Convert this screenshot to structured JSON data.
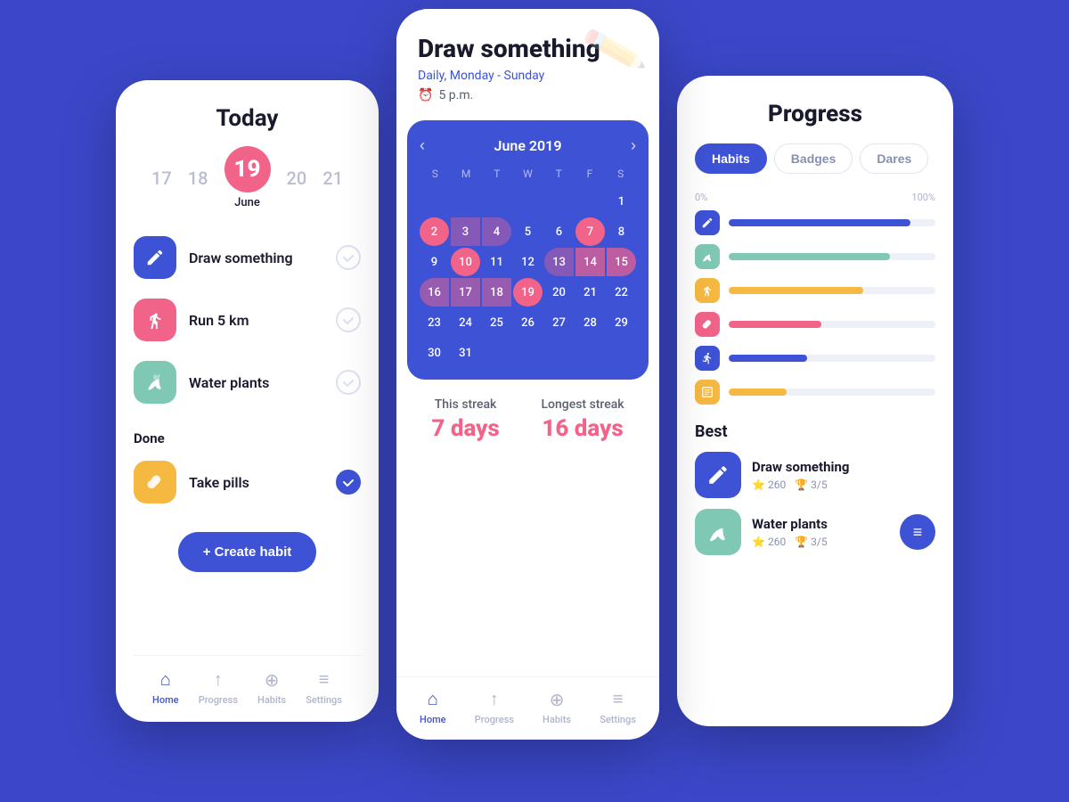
{
  "app": {
    "bg_color": "#3b47c8"
  },
  "left_phone": {
    "header": "Today",
    "dates": [
      "17",
      "18",
      "19",
      "20",
      "21"
    ],
    "today_num": "19",
    "today_month": "June",
    "habits": [
      {
        "name": "Draw something",
        "icon": "✏️",
        "color": "blue",
        "done": false
      },
      {
        "name": "Run 5 km",
        "icon": "👟",
        "color": "pink",
        "done": false
      },
      {
        "name": "Water plants",
        "icon": "🌿",
        "color": "teal",
        "done": false
      }
    ],
    "done_label": "Done",
    "done_habits": [
      {
        "name": "Take pills",
        "icon": "💊",
        "color": "yellow",
        "done": true
      }
    ],
    "create_btn": "+ Create habit",
    "nav": [
      {
        "label": "Home",
        "icon": "🏠",
        "active": true
      },
      {
        "label": "Progress",
        "icon": "📊",
        "active": false
      },
      {
        "label": "Habits",
        "icon": "➕",
        "active": false
      },
      {
        "label": "Settings",
        "icon": "⚙️",
        "active": false
      }
    ]
  },
  "center_phone": {
    "title": "Draw something",
    "subtitle": "Daily, Monday - Sunday",
    "time": "5 p.m.",
    "calendar": {
      "month": "June 2019",
      "day_headers": [
        "S",
        "M",
        "T",
        "W",
        "T",
        "F",
        "S"
      ],
      "streak_label": "This streak",
      "streak_value": "7 days",
      "longest_label": "Longest streak",
      "longest_value": "16 days"
    },
    "nav": [
      {
        "label": "Home",
        "icon": "🏠",
        "active": true
      },
      {
        "label": "Progress",
        "icon": "📊",
        "active": false
      },
      {
        "label": "Habits",
        "icon": "➕",
        "active": false
      },
      {
        "label": "Settings",
        "icon": "⚙️",
        "active": false
      }
    ]
  },
  "right_phone": {
    "title": "Progress",
    "tabs": [
      {
        "label": "Habits",
        "active": true
      },
      {
        "label": "Badges",
        "active": false
      },
      {
        "label": "Dares",
        "active": false
      }
    ],
    "pct_start": "0%",
    "pct_end": "100%",
    "bars": [
      {
        "icon": "✏️",
        "color": "#3d52d5",
        "fill": 0.88
      },
      {
        "icon": "🌿",
        "color": "#7ec8b4",
        "fill": 0.78
      },
      {
        "icon": "👟",
        "color": "#f5b942",
        "fill": 0.65
      },
      {
        "icon": "💊",
        "color": "#f2638a",
        "fill": 0.45
      },
      {
        "icon": "🏃",
        "color": "#3d52d5",
        "fill": 0.38
      },
      {
        "icon": "📓",
        "color": "#f5b942",
        "fill": 0.28
      }
    ],
    "best_label": "Best",
    "best_items": [
      {
        "name": "Draw something",
        "icon": "✏️",
        "color": "#3d52d5",
        "stars": "260",
        "trophy": "3/5"
      },
      {
        "name": "Water plants",
        "icon": "🌿",
        "color": "#7ec8b4",
        "stars": "260",
        "trophy": "3/5"
      }
    ]
  }
}
